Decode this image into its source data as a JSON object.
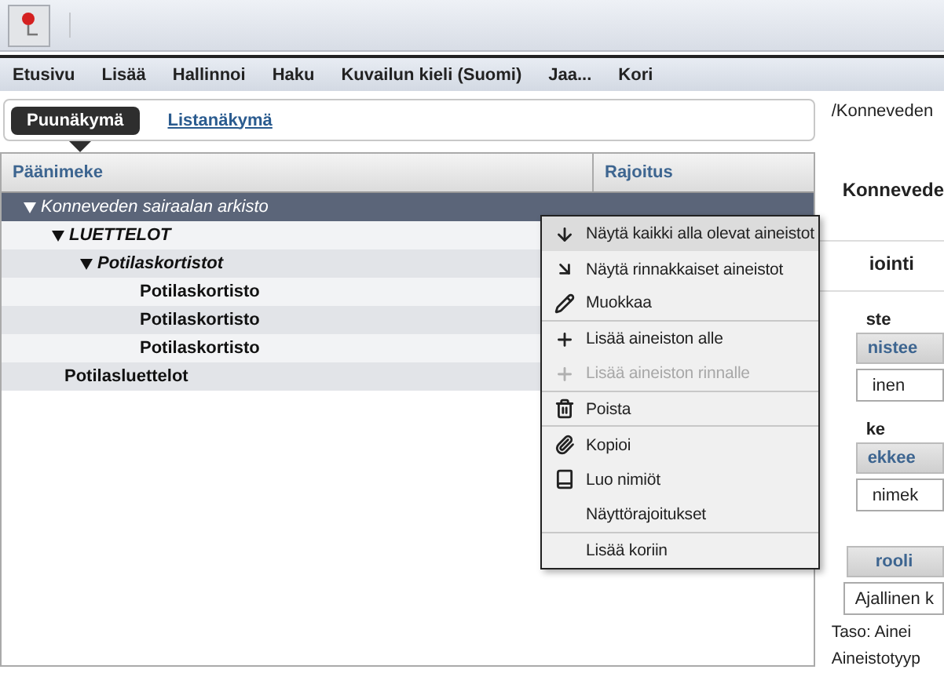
{
  "menu_bar": [
    "Etusivu",
    "Lisää",
    "Hallinnoi",
    "Haku",
    "Kuvailun kieli (Suomi)",
    "Jaa...",
    "Kori"
  ],
  "view_tabs": [
    {
      "label": "Puunäkymä",
      "selected": true
    },
    {
      "label": "Listanäkymä",
      "selected": false
    }
  ],
  "table": {
    "columns": [
      "Päänimeke",
      "Rajoitus"
    ],
    "tree": [
      {
        "title": "Konneveden sairaalan arkisto",
        "expanded": true,
        "selected": true,
        "children": [
          {
            "title": "LUETTELOT",
            "expanded": true,
            "selected": false,
            "children": [
              {
                "title": "Potilaskortistot",
                "expanded": true,
                "selected": false,
                "children": [
                  {
                    "title": "Potilaskortisto",
                    "selected": false
                  },
                  {
                    "title": "Potilaskortisto",
                    "selected": false
                  },
                  {
                    "title": "Potilaskortisto",
                    "selected": false
                  }
                ]
              }
            ]
          },
          {
            "title": "Potilasluettelot",
            "selected": false
          }
        ]
      }
    ]
  },
  "context_menu": [
    {
      "label": "Näytä kaikki alla olevat aineistot",
      "disabled": false,
      "highlighted": true,
      "separator": false
    },
    {
      "label": "Näytä rinnakkaiset aineistot",
      "disabled": false,
      "highlighted": false,
      "separator": false
    },
    {
      "label": "Muokkaa",
      "disabled": false,
      "highlighted": false,
      "separator": true
    },
    {
      "label": "Lisää aineiston alle",
      "disabled": false,
      "highlighted": false,
      "separator": false
    },
    {
      "label": "Lisää aineiston rinnalle",
      "disabled": true,
      "highlighted": false,
      "separator": true
    },
    {
      "label": "Poista",
      "disabled": false,
      "highlighted": false,
      "separator": true
    },
    {
      "label": "Kopioi",
      "disabled": false,
      "highlighted": false,
      "separator": false
    },
    {
      "label": "Luo nimiöt",
      "disabled": false,
      "highlighted": false,
      "separator": false
    },
    {
      "label": "Näyttörajoitukset",
      "disabled": false,
      "highlighted": false,
      "separator": true
    },
    {
      "label": "Lisää koriin",
      "disabled": false,
      "highlighted": false,
      "separator": false
    }
  ],
  "right_panel": [
    {
      "kind": "path",
      "text": "/Konneveden"
    },
    {
      "kind": "title",
      "text": "Konnevede"
    },
    {
      "kind": "section",
      "text": "iointi"
    },
    {
      "kind": "label",
      "text": "ste"
    },
    {
      "kind": "button",
      "text": "nistee"
    },
    {
      "kind": "field",
      "text": "inen"
    },
    {
      "kind": "label",
      "text": "ke"
    },
    {
      "kind": "button",
      "text": "ekkee"
    },
    {
      "kind": "field",
      "text": "nimek"
    },
    {
      "kind": "button",
      "text": "rooli"
    },
    {
      "kind": "field",
      "text": "Ajallinen k"
    },
    {
      "kind": "text",
      "text": "Taso: Ainei"
    },
    {
      "kind": "text",
      "text": "Aineistotyyp"
    }
  ]
}
